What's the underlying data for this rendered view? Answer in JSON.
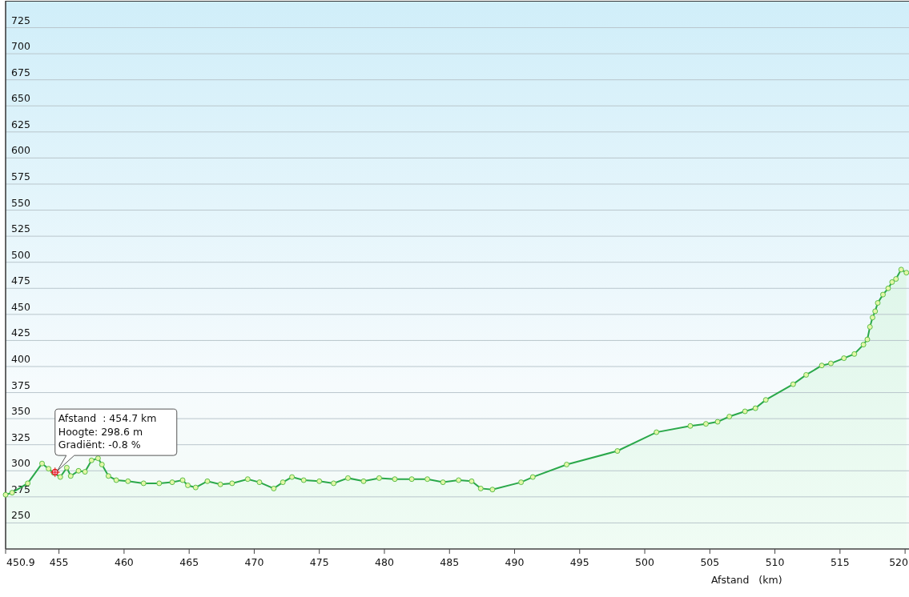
{
  "chart_data": {
    "type": "area",
    "xlabel": "Afstand   (km)",
    "xlim": [
      450.9,
      520.3
    ],
    "ylim": [
      225,
      750
    ],
    "grid": true,
    "xticks": [
      {
        "value": 450.9,
        "label": "450.9"
      },
      455,
      460,
      465,
      470,
      475,
      480,
      485,
      490,
      495,
      500,
      505,
      510,
      515,
      520
    ],
    "yticks": [
      250,
      275,
      300,
      325,
      350,
      375,
      400,
      425,
      450,
      475,
      500,
      525,
      550,
      575,
      600,
      625,
      650,
      675,
      700,
      725
    ],
    "x": [
      450.9,
      451.4,
      452.6,
      453.7,
      454.2,
      454.6,
      455.1,
      455.6,
      455.9,
      456.5,
      457.0,
      457.5,
      458.0,
      458.3,
      458.8,
      459.4,
      460.3,
      461.5,
      462.7,
      463.7,
      464.5,
      464.9,
      465.5,
      466.4,
      467.4,
      468.3,
      469.5,
      470.4,
      471.5,
      472.2,
      472.9,
      473.8,
      475.0,
      476.1,
      477.2,
      478.4,
      479.6,
      480.8,
      482.1,
      483.3,
      484.5,
      485.7,
      486.7,
      487.4,
      488.3,
      490.5,
      491.4,
      494.0,
      497.9,
      500.9,
      503.5,
      504.7,
      505.6,
      506.5,
      507.7,
      508.5,
      509.3,
      511.4,
      512.4,
      513.6,
      514.3,
      515.3,
      516.1,
      516.8,
      517.1,
      517.3,
      517.5,
      517.7,
      517.9,
      518.3,
      518.7,
      519.0,
      519.3,
      519.7,
      520.1
    ],
    "series": [
      {
        "color": "#2aa84a",
        "values": [
          277,
          279,
          288,
          307,
          302,
          298,
          294,
          303,
          295,
          300,
          299,
          310,
          312,
          306,
          295,
          291,
          290,
          288,
          288,
          289,
          291,
          286,
          284,
          290,
          287,
          288,
          292,
          289,
          283,
          289,
          294,
          291,
          290,
          288,
          293,
          290,
          293,
          292,
          292,
          292,
          289,
          291,
          290,
          283,
          282,
          289,
          294,
          306,
          319,
          337,
          343,
          345,
          347,
          352,
          357,
          360,
          368,
          383,
          392,
          401,
          403,
          408,
          412,
          421,
          426,
          438,
          447,
          453,
          461,
          469,
          475,
          481,
          484,
          493,
          490
        ]
      }
    ],
    "annotations": [
      {
        "x": 454.7,
        "y": 298.6,
        "text": "Afstand  : 454.7 km\nHoogte: 298.6 m\nGradiënt: -0.8 %"
      }
    ]
  }
}
